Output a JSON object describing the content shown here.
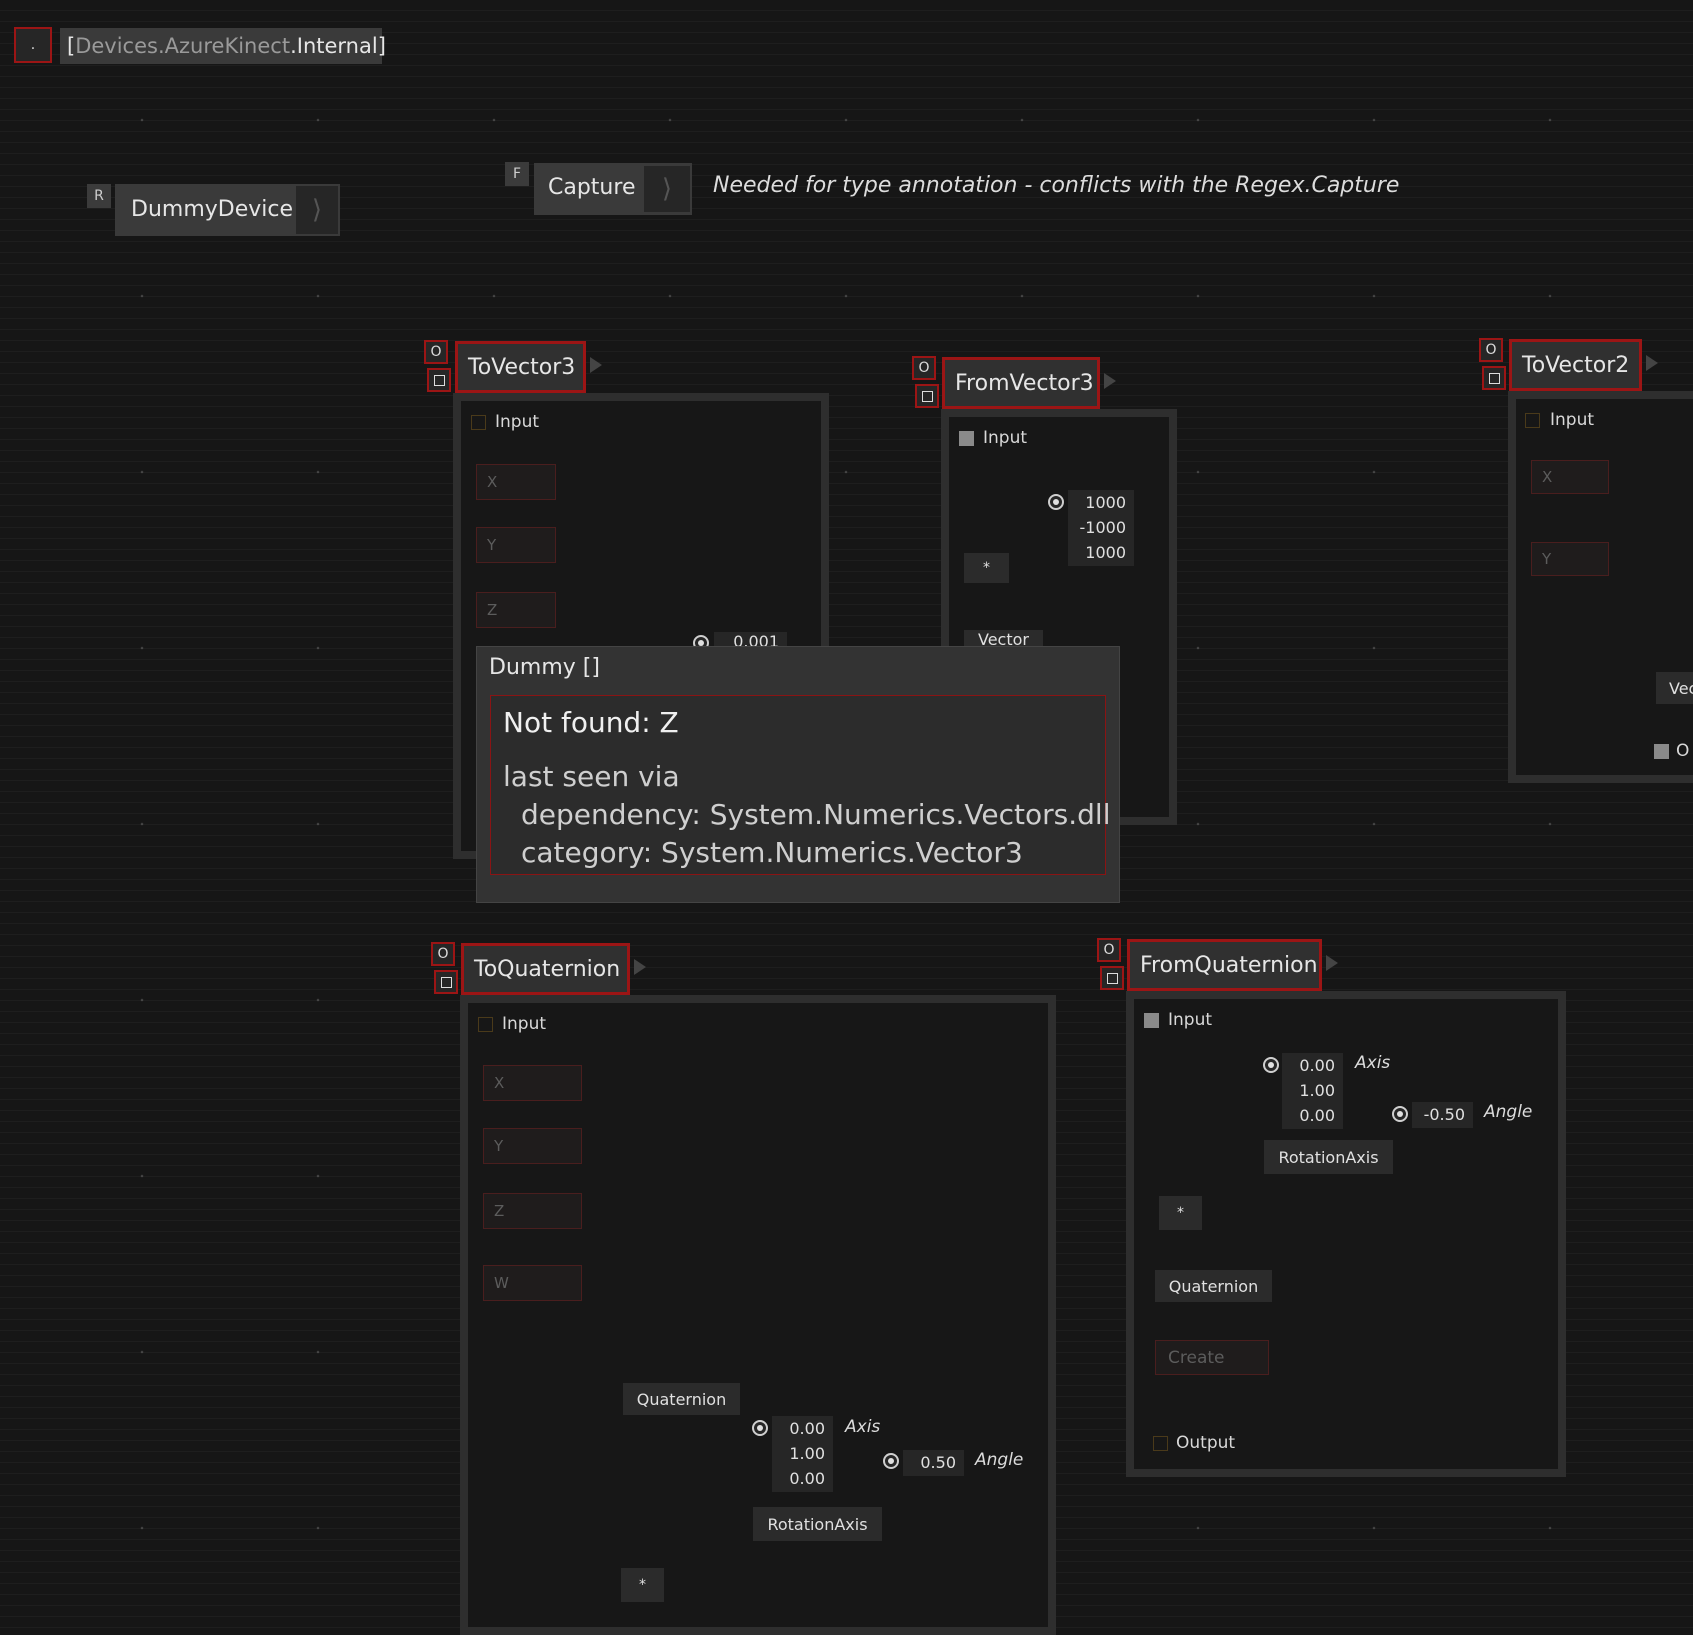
{
  "header": {
    "dot_button": ".",
    "ns_open": "[",
    "ns_part1": "Devices",
    "ns_sep1": ".",
    "ns_part2": "AzureKinect",
    "ns_sep2": ".",
    "ns_part3": "Internal",
    "ns_close": "]"
  },
  "dummy_device": {
    "badge": "R",
    "label": "DummyDevice"
  },
  "capture": {
    "badge": "F",
    "label": "Capture",
    "comment": "Needed for type annotation - conflicts with the Regex.Capture"
  },
  "flag_o": "O",
  "to_vector3": {
    "title": "ToVector3",
    "input": "Input",
    "x": "X",
    "y": "Y",
    "z": "Z",
    "value": "0.001"
  },
  "from_vector3": {
    "title": "FromVector3",
    "input": "Input",
    "values": [
      "1000",
      "-1000",
      "1000"
    ],
    "multiply": "*",
    "vector": "Vector"
  },
  "to_vector2": {
    "title": "ToVector2",
    "input": "Input",
    "x": "X",
    "y": "Y",
    "vec": "Vec",
    "out": "O"
  },
  "tooltip": {
    "title": "Dummy []",
    "heading": "Not found: Z",
    "line1": "last seen via",
    "line2": "dependency: System.Numerics.Vectors.dll",
    "line3": "category: System.Numerics.Vector3"
  },
  "to_quaternion": {
    "title": "ToQuaternion",
    "input": "Input",
    "x": "X",
    "y": "Y",
    "z": "Z",
    "w": "W",
    "quaternion": "Quaternion",
    "axis_values": [
      "0.00",
      "1.00",
      "0.00"
    ],
    "axis_label": "Axis",
    "angle_value": "0.50",
    "angle_label": "Angle",
    "rotation_axis": "RotationAxis",
    "multiply": "*"
  },
  "from_quaternion": {
    "title": "FromQuaternion",
    "input": "Input",
    "axis_values": [
      "0.00",
      "1.00",
      "0.00"
    ],
    "axis_label": "Axis",
    "angle_value": "-0.50",
    "angle_label": "Angle",
    "rotation_axis": "RotationAxis",
    "multiply": "*",
    "quaternion": "Quaternion",
    "create": "Create",
    "output": "Output"
  }
}
